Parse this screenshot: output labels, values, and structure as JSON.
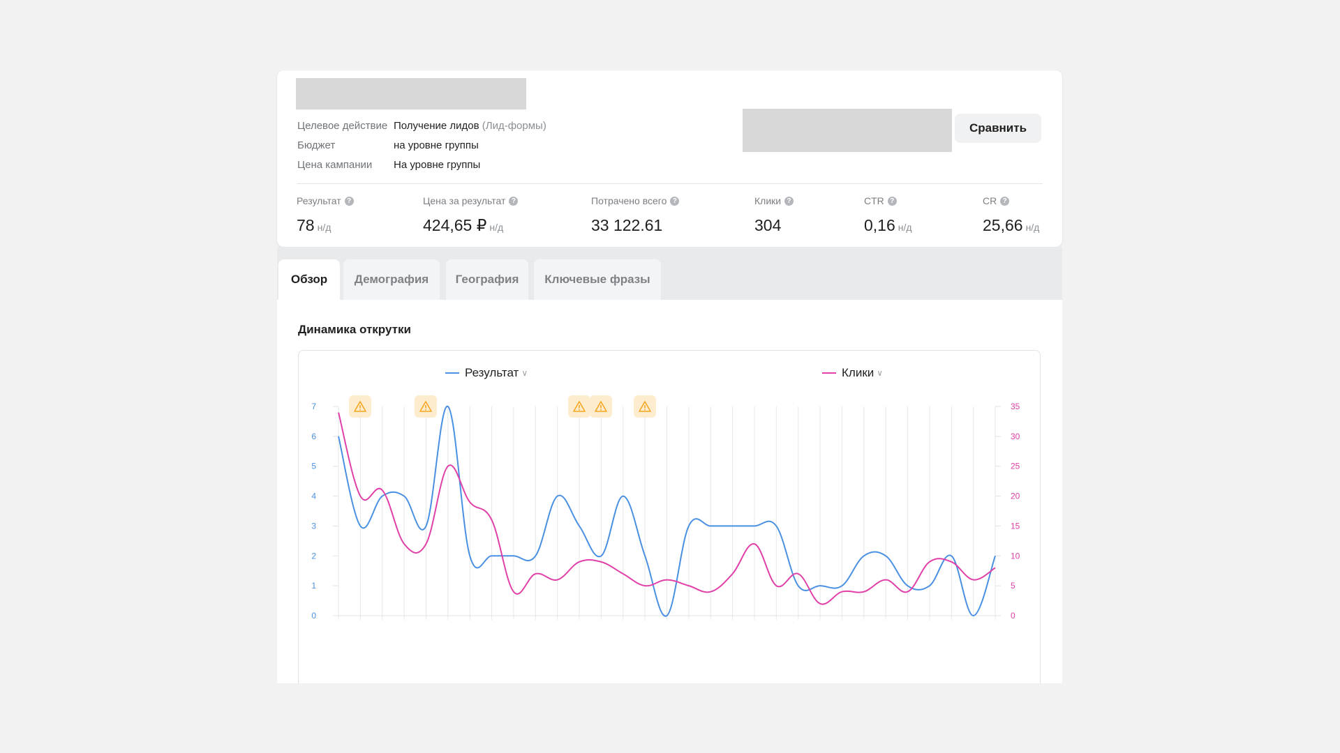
{
  "campaign": {
    "meta": [
      {
        "label": "Целевое действие",
        "value": "Получение лидов",
        "value_extra": "(Лид-формы)"
      },
      {
        "label": "Бюджет",
        "value": "на уровне группы",
        "value_extra": ""
      },
      {
        "label": "Цена кампании",
        "value": "На уровне группы",
        "value_extra": ""
      }
    ],
    "compare_label": "Сравнить"
  },
  "stats": [
    {
      "label": "Результат",
      "value": "78",
      "suffix": "н/д"
    },
    {
      "label": "Цена за результат",
      "value": "424,65 ₽",
      "suffix": "н/д"
    },
    {
      "label": "Потрачено всего",
      "value": "33 122.61",
      "suffix": ""
    },
    {
      "label": "Клики",
      "value": "304",
      "suffix": ""
    },
    {
      "label": "CTR",
      "value": "0,16",
      "suffix": "н/д"
    },
    {
      "label": "CR",
      "value": "25,66",
      "suffix": "н/д"
    }
  ],
  "tabs": [
    {
      "label": "Обзор",
      "active": true
    },
    {
      "label": "Демография",
      "active": false
    },
    {
      "label": "География",
      "active": false
    },
    {
      "label": "Ключевые фразы",
      "active": false
    }
  ],
  "section_title": "Динамика открутки",
  "icons": {
    "help": "question-circle-icon",
    "warning": "warning-triangle-icon",
    "chevron": "chevron-down-icon"
  },
  "colors": {
    "result": "#4a90e2",
    "clicks": "#e040a8",
    "warning_bg": "#fdeccd",
    "warning_fg": "#f5a623"
  },
  "chart_data": {
    "type": "line",
    "grid": "vertical",
    "legend_position": "top",
    "x_count": 31,
    "y_left": {
      "ticks": [
        "0",
        "1",
        "2",
        "3",
        "4",
        "5",
        "6",
        "7"
      ],
      "range": [
        0,
        7
      ]
    },
    "y_right": {
      "ticks": [
        "0",
        "5",
        "10",
        "15",
        "20",
        "25",
        "30",
        "35"
      ],
      "range": [
        0,
        35
      ]
    },
    "series": [
      {
        "name": "Результат",
        "axis": "left",
        "color": "#4a90e2",
        "values": [
          6,
          3,
          4,
          4,
          3,
          7,
          2,
          2,
          2,
          2,
          4,
          3,
          2,
          4,
          2,
          0,
          3,
          3,
          3,
          3,
          3,
          1,
          1,
          1,
          2,
          2,
          1,
          1,
          2,
          0,
          2
        ]
      },
      {
        "name": "Клики",
        "axis": "right",
        "color": "#e040a8",
        "values": [
          34,
          20,
          21,
          12,
          12,
          25,
          19,
          16,
          4,
          7,
          6,
          9,
          9,
          7,
          5,
          6,
          5,
          4,
          7,
          12,
          5,
          7,
          2,
          4,
          4,
          6,
          4,
          9,
          9,
          6,
          8
        ]
      }
    ],
    "warnings_at": [
      1,
      4,
      11,
      12,
      14
    ]
  }
}
